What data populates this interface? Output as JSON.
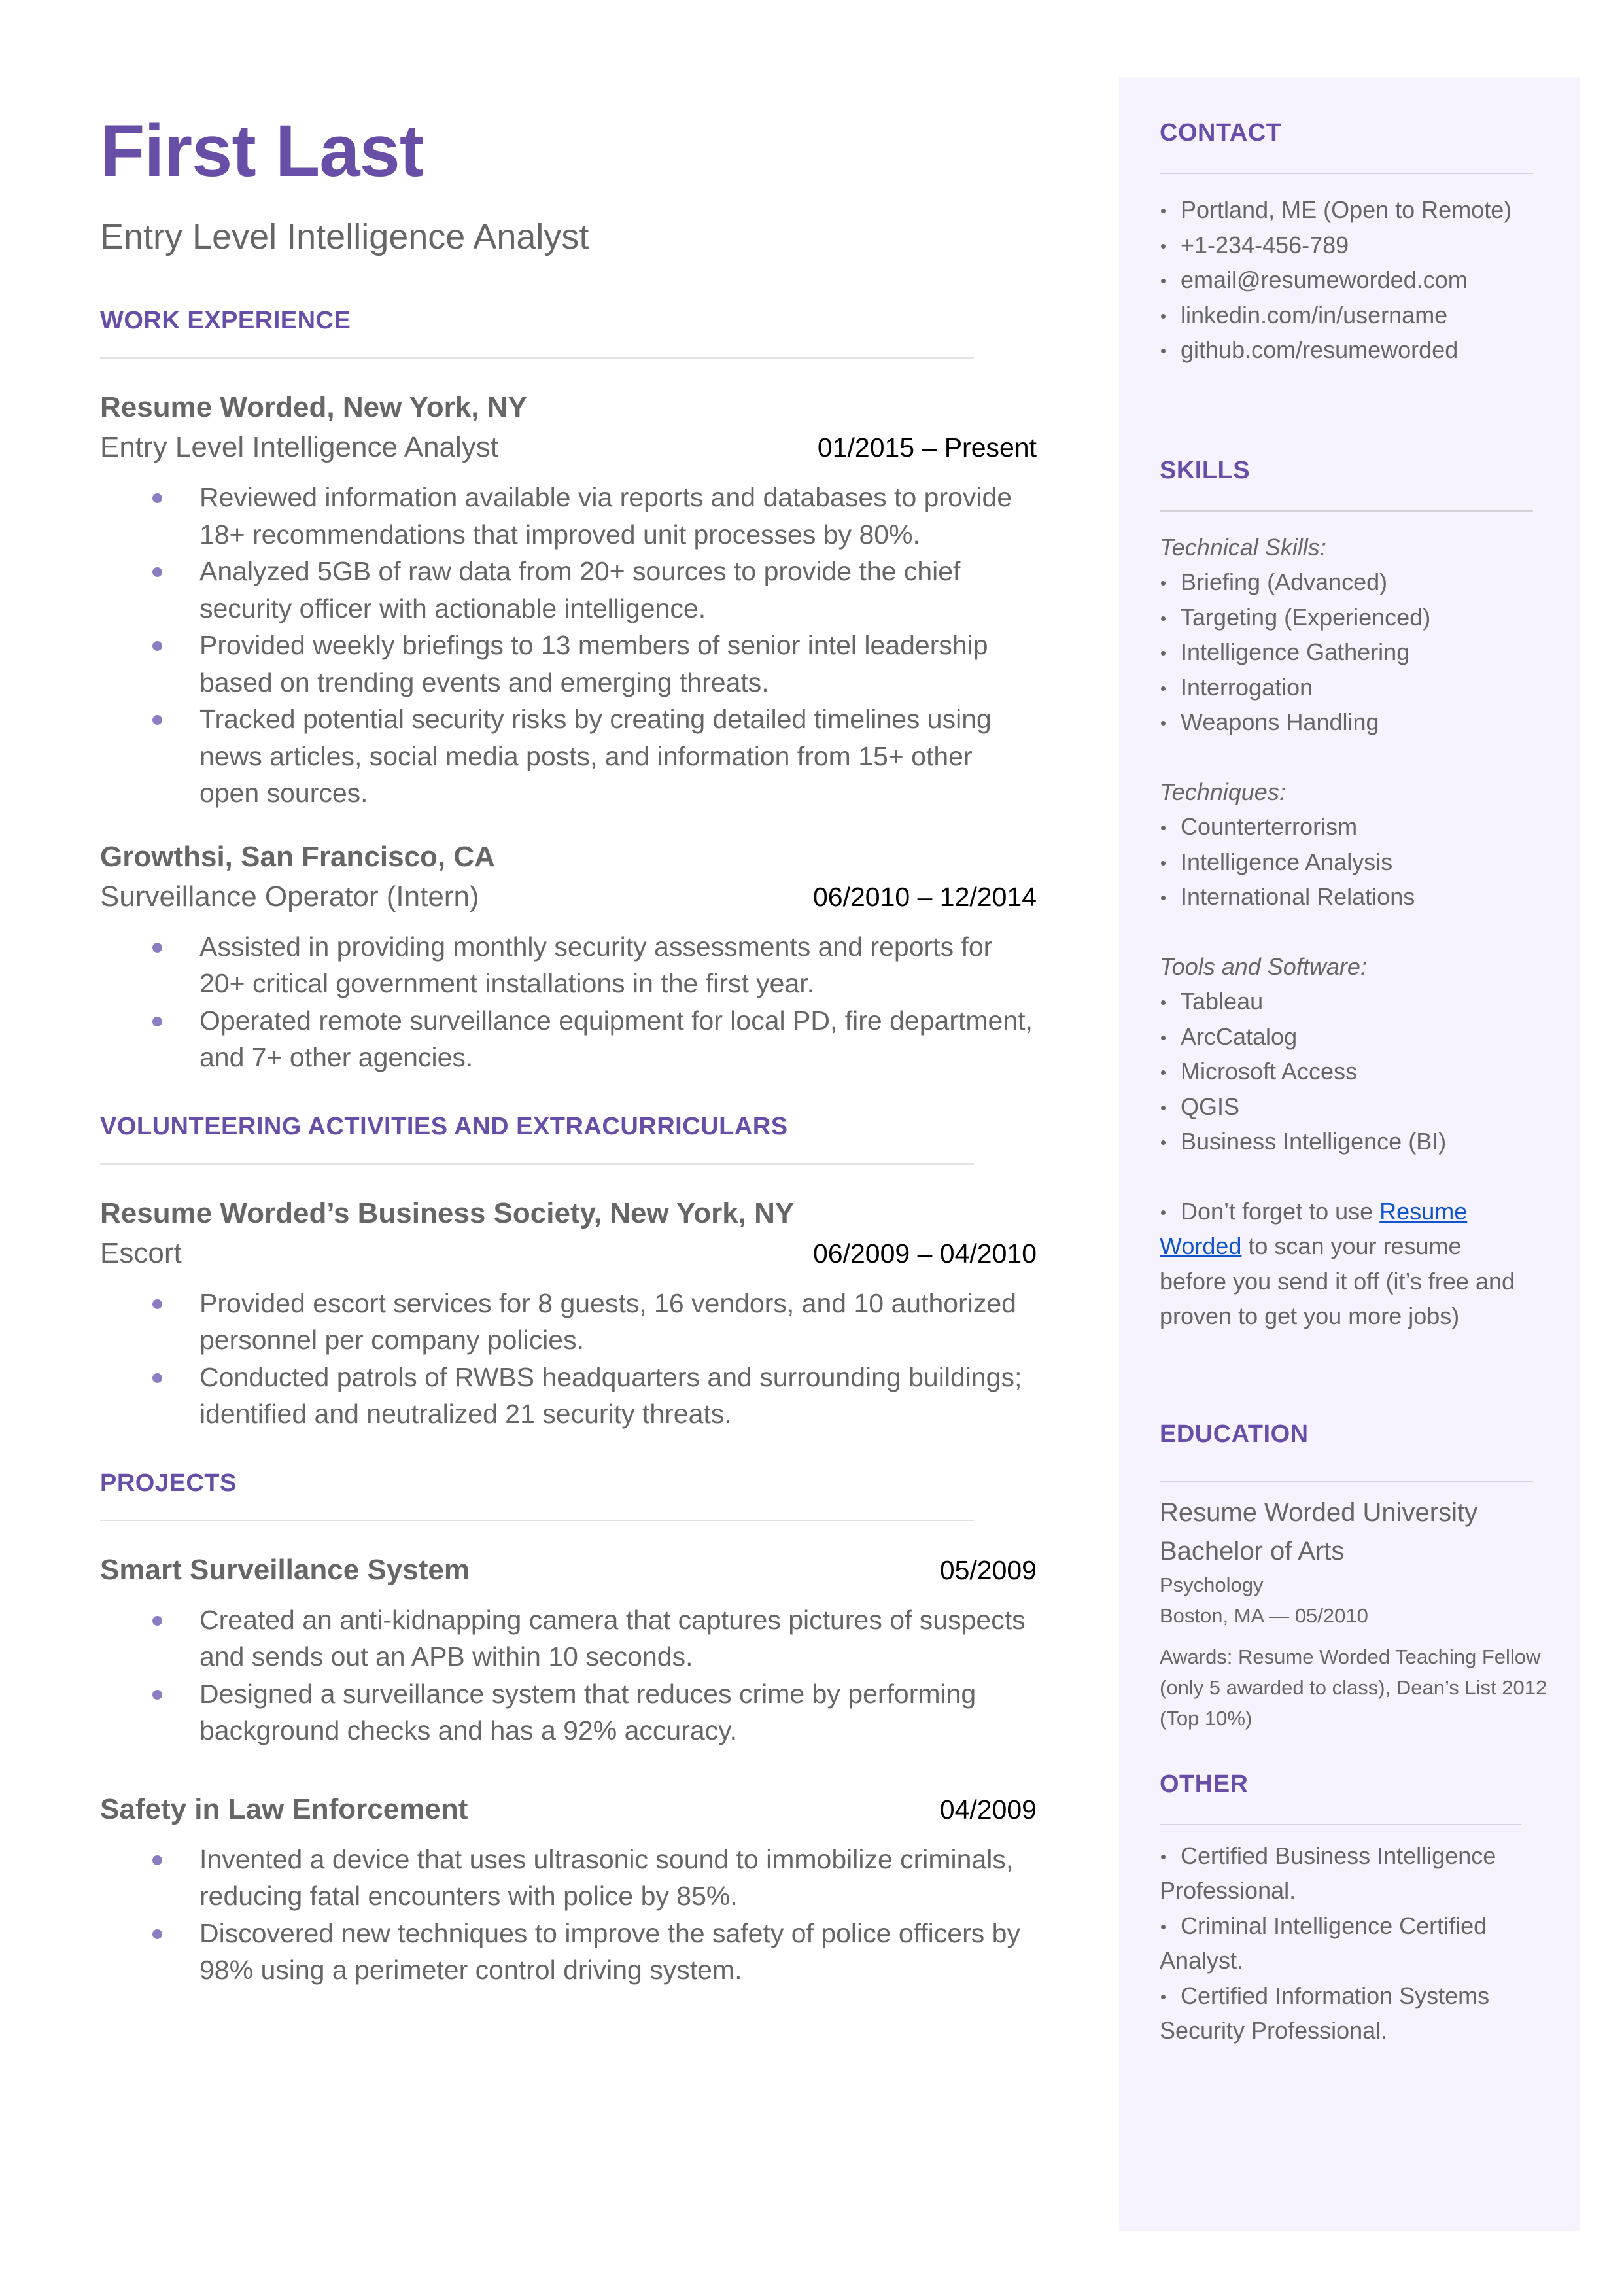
{
  "header": {
    "name": "First Last",
    "title": "Entry Level Intelligence Analyst"
  },
  "colors": {
    "accent": "#674EA7",
    "bullet": "#8E7CC3",
    "sidebar_bg": "#F6F3FE",
    "text": "#666666",
    "link": "#1155CC"
  },
  "work_experience": {
    "heading": "WORK EXPERIENCE",
    "entries": [
      {
        "company": "Resume Worded, New York, NY",
        "role": "Entry Level Intelligence Analyst",
        "dates": "01/2015 – Present",
        "bullets": [
          "Reviewed information available via reports and databases to provide 18+ recommendations that improved unit processes by 80%.",
          "Analyzed 5GB of raw data from 20+ sources to provide the chief security officer with actionable intelligence.",
          "Provided weekly briefings to 13 members of senior intel leadership based on trending events and emerging threats.",
          "Tracked potential security risks by creating detailed timelines using news articles, social media posts, and information from 15+ other open sources."
        ]
      },
      {
        "company": "Growthsi, San Francisco, CA",
        "role": "Surveillance Operator (Intern)",
        "dates": "06/2010 – 12/2014",
        "bullets": [
          "Assisted in providing monthly security assessments and reports for 20+ critical government installations in the first year.",
          "Operated remote surveillance equipment for local PD, fire department, and 7+ other agencies."
        ]
      }
    ]
  },
  "volunteering": {
    "heading": "VOLUNTEERING ACTIVITIES AND EXTRACURRICULARS",
    "entries": [
      {
        "org": "Resume Worded’s Business Society, New York, NY",
        "role": "Escort",
        "dates": "06/2009 – 04/2010",
        "bullets": [
          "Provided escort services for 8 guests, 16 vendors, and 10 authorized personnel per company policies.",
          "Conducted patrols of RWBS headquarters and surrounding buildings; identified and neutralized 21 security threats."
        ]
      }
    ]
  },
  "projects": {
    "heading": "PROJECTS",
    "entries": [
      {
        "name": "Smart Surveillance System",
        "date": "05/2009",
        "bullets": [
          "Created an anti-kidnapping camera that captures pictures of suspects and sends out an APB within 10 seconds.",
          "Designed a surveillance system that reduces crime by performing background checks and has a 92% accuracy."
        ]
      },
      {
        "name": "Safety in Law Enforcement",
        "date": "04/2009",
        "bullets": [
          "Invented a device that uses ultrasonic sound to immobilize criminals, reducing fatal encounters with police by 85%.",
          "Discovered new techniques to improve the safety of police officers by 98% using a perimeter control driving system."
        ]
      }
    ]
  },
  "sidebar": {
    "contact": {
      "heading": "CONTACT",
      "items": [
        "Portland, ME (Open to Remote)",
        "+1-234-456-789",
        "email@resumeworded.com",
        "linkedin.com/in/username",
        "github.com/resumeworded"
      ]
    },
    "skills": {
      "heading": "SKILLS",
      "groups": [
        {
          "label": "Technical Skills:",
          "items": [
            "Briefing (Advanced)",
            "Targeting (Experienced)",
            "Intelligence Gathering",
            "Interrogation",
            "Weapons Handling"
          ]
        },
        {
          "label": "Techniques:",
          "items": [
            "Counterterrorism",
            "Intelligence Analysis",
            "International Relations"
          ]
        },
        {
          "label": "Tools and Software:",
          "items": [
            "Tableau",
            "ArcCatalog",
            "Microsoft Access",
            "QGIS",
            "Business Intelligence (BI)"
          ]
        }
      ],
      "tip_prefix": "Don’t forget to use ",
      "tip_link": "Resume Worded",
      "tip_suffix": " to scan your resume before you send it off (it’s free and proven to get you more jobs)"
    },
    "education": {
      "heading": "EDUCATION",
      "school": "Resume Worded University",
      "degree": "Bachelor of Arts",
      "field": "Psychology",
      "location_date": "Boston, MA — 05/2010",
      "awards": "Awards: Resume Worded Teaching Fellow (only 5 awarded to class), Dean’s List 2012 (Top 10%)"
    },
    "other": {
      "heading": "OTHER",
      "items": [
        "Certified Business Intelligence Professional.",
        "Criminal Intelligence Certified Analyst.",
        "Certified Information Systems Security Professional."
      ]
    }
  }
}
